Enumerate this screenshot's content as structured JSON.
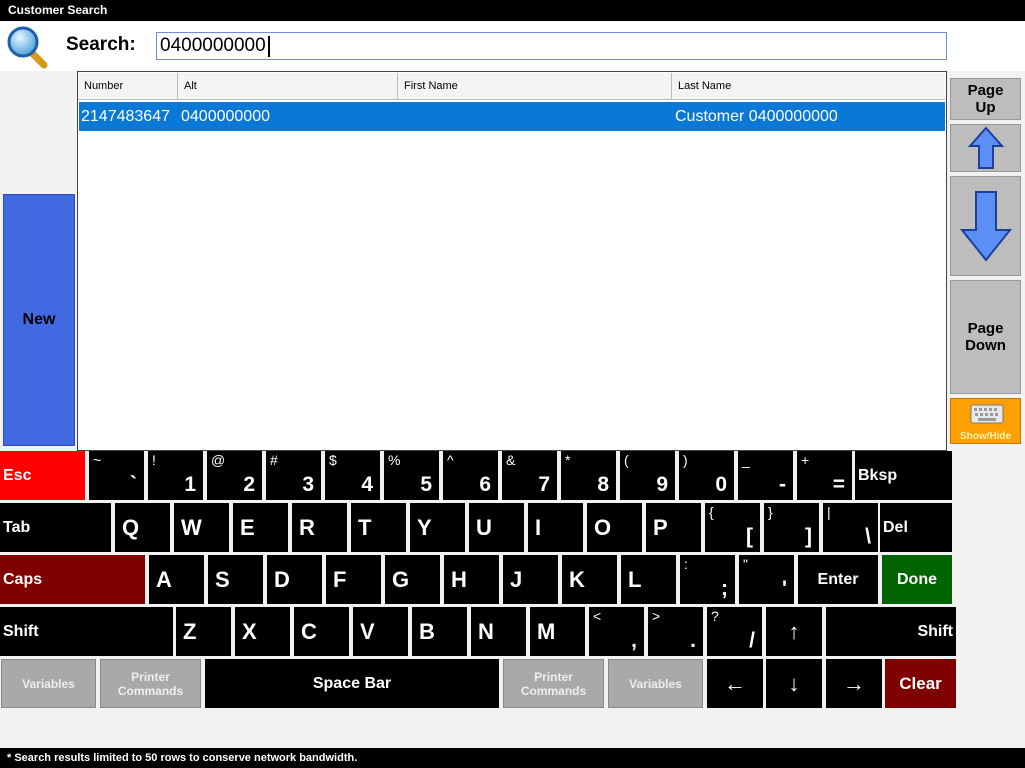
{
  "window": {
    "title": "Customer Search"
  },
  "search": {
    "label": "Search:",
    "value": "0400000000"
  },
  "table": {
    "columns": [
      "Number",
      "Alt",
      "First Name",
      "Last Name"
    ],
    "rows": [
      {
        "number": "2147483647",
        "alt": "0400000000",
        "first_name": "",
        "last_name": "Customer 0400000000"
      }
    ]
  },
  "sidebar": {
    "new_label": "New"
  },
  "nav": {
    "page_up_1": "Page",
    "page_up_2": "Up",
    "page_down_1": "Page",
    "page_down_2": "Down",
    "show_hide": "Show/Hide"
  },
  "keyboard": {
    "esc": "Esc",
    "bksp": "Bksp",
    "tab": "Tab",
    "del": "Del",
    "caps": "Caps",
    "enter": "Enter",
    "done": "Done",
    "shift_left": "Shift",
    "shift_right": "Shift",
    "number_row": [
      {
        "s": "~",
        "m": "`"
      },
      {
        "s": "!",
        "m": "1"
      },
      {
        "s": "@",
        "m": "2"
      },
      {
        "s": "#",
        "m": "3"
      },
      {
        "s": "$",
        "m": "4"
      },
      {
        "s": "%",
        "m": "5"
      },
      {
        "s": "^",
        "m": "6"
      },
      {
        "s": "&",
        "m": "7"
      },
      {
        "s": "*",
        "m": "8"
      },
      {
        "s": "(",
        "m": "9"
      },
      {
        "s": ")",
        "m": "0"
      },
      {
        "s": "_",
        "m": "-"
      },
      {
        "s": "+",
        "m": "="
      }
    ],
    "q_row": [
      "Q",
      "W",
      "E",
      "R",
      "T",
      "Y",
      "U",
      "I",
      "O",
      "P"
    ],
    "q_row_sym": [
      {
        "s": "{",
        "m": "["
      },
      {
        "s": "}",
        "m": "]"
      },
      {
        "s": "|",
        "m": "\\"
      }
    ],
    "a_row": [
      "A",
      "S",
      "D",
      "F",
      "G",
      "H",
      "J",
      "K",
      "L"
    ],
    "a_row_sym": [
      {
        "s": ":",
        "m": ";"
      },
      {
        "s": "\"",
        "m": "'"
      }
    ],
    "z_row": [
      "Z",
      "X",
      "C",
      "V",
      "B",
      "N",
      "M"
    ],
    "z_row_sym": [
      {
        "s": "<",
        "m": ","
      },
      {
        "s": ">",
        "m": "."
      },
      {
        "s": "?",
        "m": "/"
      }
    ],
    "arrow_up": "↑",
    "arrow_left": "←",
    "arrow_down": "↓",
    "arrow_right": "→",
    "variables_left": "Variables",
    "printer_left_1": "Printer",
    "printer_left_2": "Commands",
    "space": "Space Bar",
    "printer_right_1": "Printer",
    "printer_right_2": "Commands",
    "variables_right": "Variables",
    "clear": "Clear"
  },
  "status": {
    "text": "* Search results limited to 50 rows to conserve network bandwidth."
  },
  "colors": {
    "esc": "#ff0000",
    "caps": "#800000",
    "done": "#006400",
    "clear": "#800000",
    "new": "#4169e1",
    "selection": "#0a78d7",
    "show_hide": "#ffa000"
  },
  "icons": {
    "search": "magnifier-icon",
    "up": "arrow-up-icon",
    "down": "arrow-down-icon",
    "keyboard": "keyboard-icon"
  }
}
